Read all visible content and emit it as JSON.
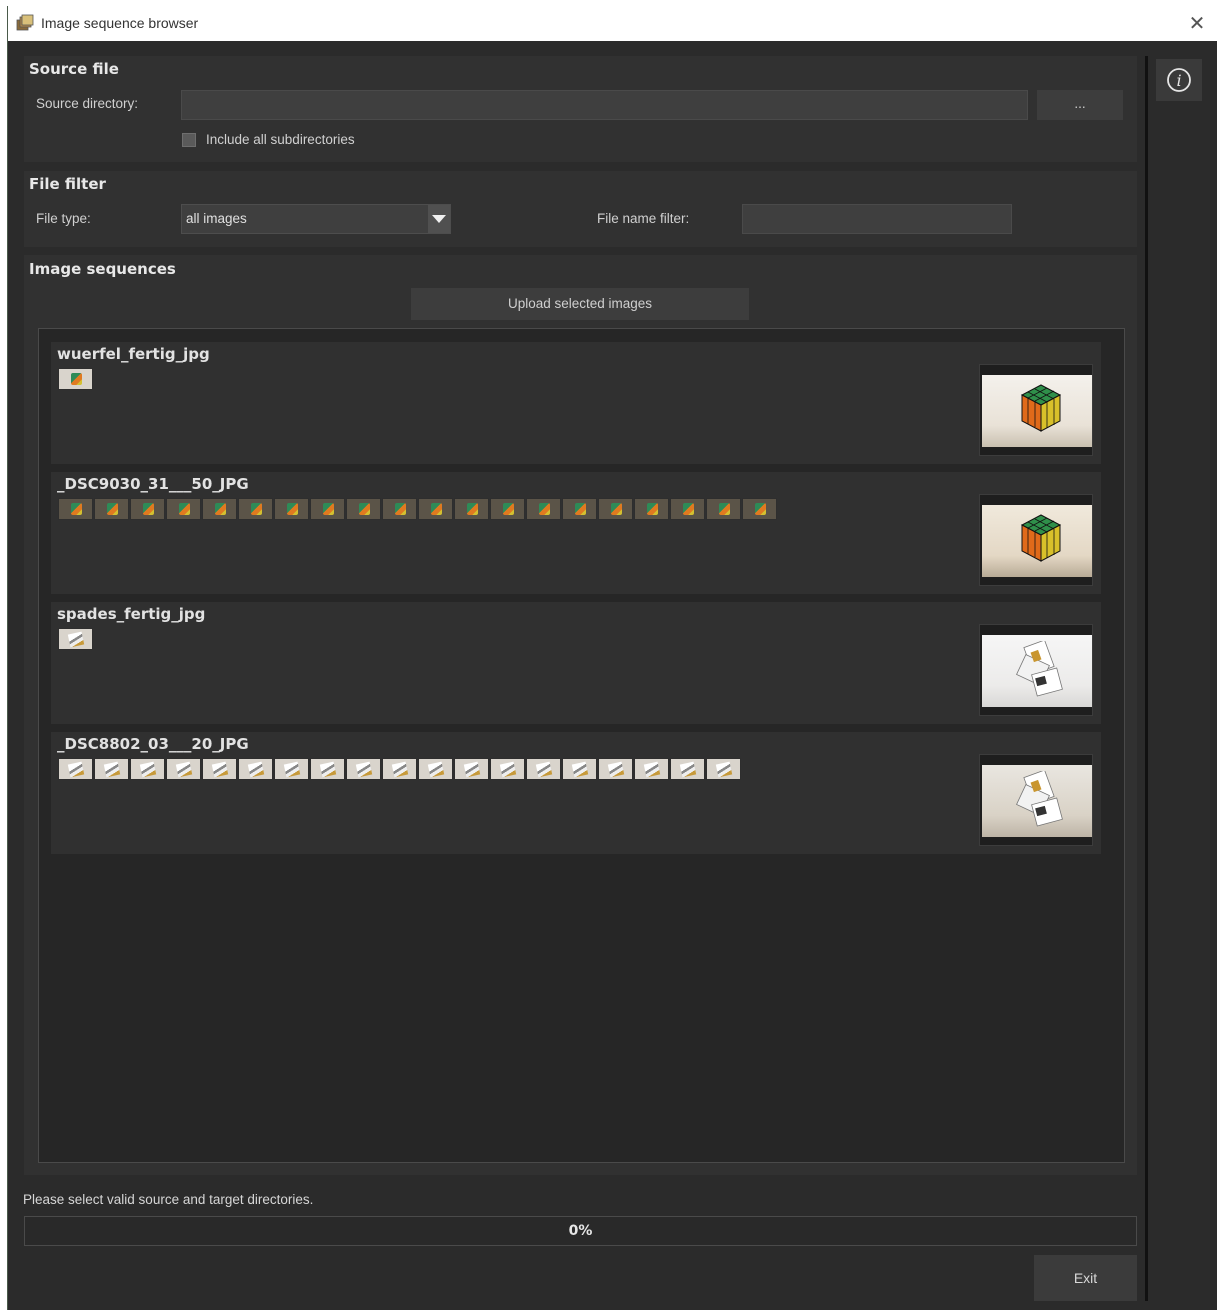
{
  "window": {
    "title": "Image sequence browser",
    "close_glyph": "✕"
  },
  "source_file": {
    "title": "Source file",
    "directory_label": "Source directory:",
    "directory_value": "",
    "browse_label": "...",
    "include_subdirs_label": "Include all subdirectories",
    "include_subdirs_checked": false
  },
  "file_filter": {
    "title": "File filter",
    "file_type_label": "File type:",
    "file_type_value": "all images",
    "name_filter_label": "File name filter:",
    "name_filter_value": ""
  },
  "image_sequences": {
    "title": "Image sequences",
    "upload_label": "Upload selected images",
    "items": [
      {
        "name": "wuerfel_fertig_jpg",
        "frame_count": 1,
        "thumb_style": "cube"
      },
      {
        "name": "_DSC9030_31___50_JPG",
        "frame_count": 20,
        "thumb_style": "cube"
      },
      {
        "name": "spades_fertig_jpg",
        "frame_count": 1,
        "thumb_style": "cards"
      },
      {
        "name": "_DSC8802_03___20_JPG",
        "frame_count": 19,
        "thumb_style": "cards"
      }
    ]
  },
  "status": {
    "message": "Please select valid source and target directories.",
    "progress_percent": 0,
    "progress_text": "0%"
  },
  "footer": {
    "exit_label": "Exit"
  },
  "icons": {
    "app": "image-stack-icon",
    "info": "info-icon",
    "dropdown": "triangle-down-icon",
    "close": "close-icon"
  },
  "colors": {
    "background": "#2b2b2b",
    "panel": "#313131",
    "field": "#3f3f3f",
    "button": "#3d3d3d"
  }
}
